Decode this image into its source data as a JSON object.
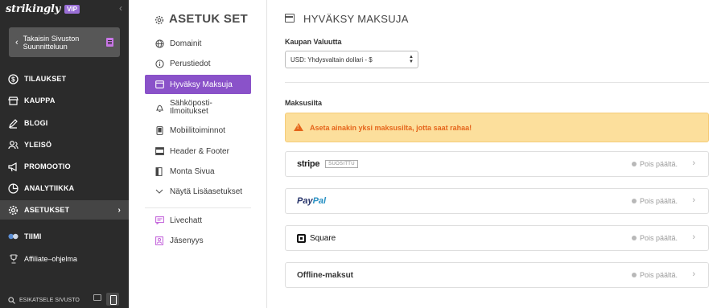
{
  "sidebar": {
    "brand": "strikingly",
    "badge": "VIP",
    "back_label": "Takaisin Sivuston Suunnitteluun",
    "items": [
      {
        "label": "TILAUKSET",
        "icon": "dollar-circle-icon"
      },
      {
        "label": "KAUPPA",
        "icon": "store-icon"
      },
      {
        "label": "BLOGI",
        "icon": "pen-icon"
      },
      {
        "label": "YLEISÖ",
        "icon": "audience-icon"
      },
      {
        "label": "PROMOOTIO",
        "icon": "megaphone-icon"
      },
      {
        "label": "ANALYTIIKKA",
        "icon": "analytics-icon"
      },
      {
        "label": "ASETUKSET",
        "icon": "gear-icon"
      },
      {
        "label": "TIIMI",
        "icon": "team-icon"
      },
      {
        "label": "Affiliate–ohjelma",
        "icon": "trophy-icon"
      }
    ],
    "preview_label": "ESIKATSELE SIVUSTO"
  },
  "settings_menu": {
    "title": "ASETUK SET",
    "items": [
      {
        "label": "Domainit",
        "icon": "globe-icon"
      },
      {
        "label": "Perustiedot",
        "icon": "info-icon"
      },
      {
        "label": "Hyväksy Maksuja",
        "icon": "card-icon"
      },
      {
        "label": "Sähköposti-Ilmoitukset",
        "icon": "bell-icon"
      },
      {
        "label": "Mobiilitoiminnot",
        "icon": "mobile-icon"
      },
      {
        "label": "Header & Footer",
        "icon": "layout-icon"
      },
      {
        "label": "Monta Sivua",
        "icon": "pages-icon"
      },
      {
        "label": "Näytä Lisäasetukset",
        "icon": "chevron-down-icon"
      },
      {
        "label": "Livechatt",
        "icon": "chat-icon"
      },
      {
        "label": "Jäsenyys",
        "icon": "member-icon"
      }
    ]
  },
  "main": {
    "title": "HYVÄKSY MAKSUJA",
    "currency_label": "Kaupan Valuutta",
    "currency_value": "USD: Yhdysvaltain dollari - $",
    "gateways_label": "Maksusilta",
    "warning": "Aseta ainakin yksi maksusilta, jotta saat rahaa!",
    "gateways": [
      {
        "name": "stripe",
        "badge": "SUOSITTU",
        "status": "Pois päältä."
      },
      {
        "name_a": "Pay",
        "name_b": "Pal",
        "status": "Pois päältä."
      },
      {
        "name": "Square",
        "status": "Pois päältä."
      },
      {
        "name": "Offline-maksut",
        "status": "Pois päältä."
      }
    ]
  },
  "colors": {
    "sidebar_bg": "#2b2b2b",
    "accent_purple": "#8a52c9",
    "warning_bg": "#fcdf9c",
    "warning_text": "#e5651b"
  }
}
